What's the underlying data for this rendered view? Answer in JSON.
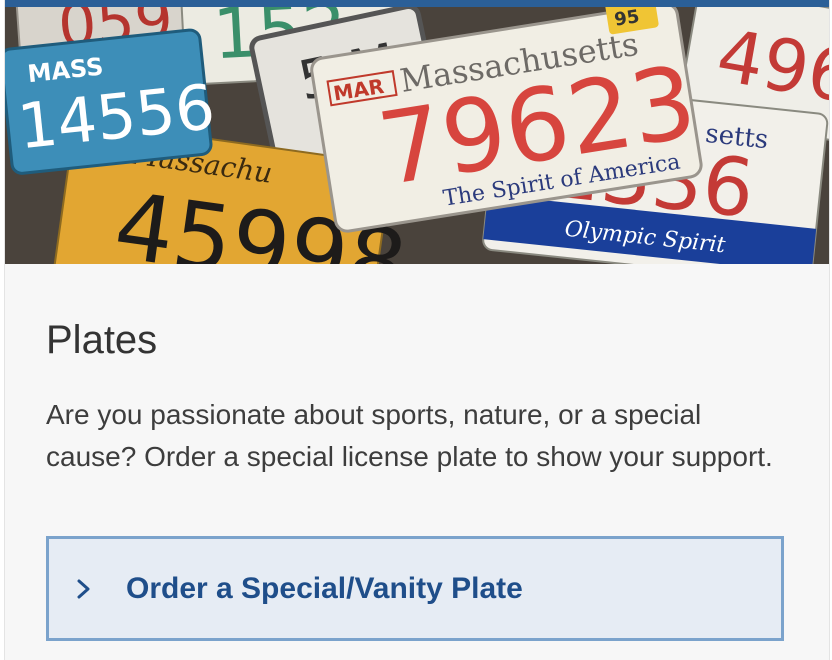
{
  "hero": {
    "image_alt": "Pile of license plates",
    "plates": [
      {
        "state": "MASS",
        "number": "14556"
      },
      {
        "state": "Massachusetts",
        "number": "79623",
        "month": "MAR",
        "year": "95",
        "slogan": "The Spirit of America"
      },
      {
        "number": "45998"
      },
      {
        "number": "1336",
        "slogan": "Olympic Spirit",
        "state": "setts"
      },
      {
        "number": "152"
      },
      {
        "number": "496"
      }
    ]
  },
  "section": {
    "title": "Plates",
    "description": "Are you passionate about sports, nature, or a special cause? Order a special license plate to show your support.",
    "link_label": "Order a Special/Vanity Plate"
  },
  "icons": {
    "link_icon": "chevron-right-icon"
  },
  "colors": {
    "accent": "#1f4e8a",
    "link_bg": "#e6ecf4",
    "link_border": "#7ba3cc",
    "top_bar": "#2b5f97"
  }
}
